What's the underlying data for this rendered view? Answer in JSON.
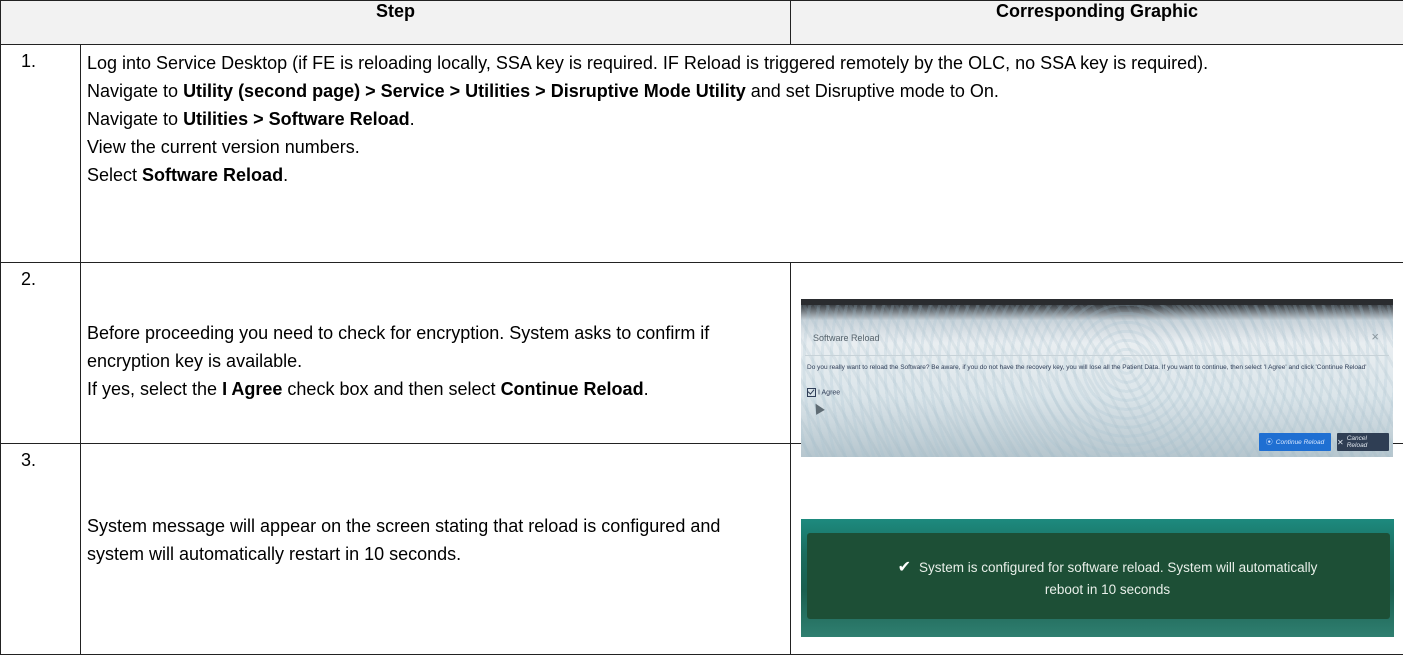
{
  "header": {
    "step": "Step",
    "graphic": "Corresponding Graphic"
  },
  "rows": [
    {
      "number": "1.",
      "line1": "Log into Service Desktop (if FE is reloading locally, SSA key is required. IF Reload is triggered remotely by the OLC, no SSA key is required).",
      "line2_prefix": "Navigate to ",
      "line2_bold": "Utility (second page) > Service > Utilities > Disruptive Mode Utility",
      "line2_suffix": " and set Disruptive mode to On.",
      "line3_prefix": "Navigate to ",
      "line3_bold": "Utilities > Software Reload",
      "line3_suffix": ".",
      "line4": "View the current version numbers.",
      "line5_prefix": "Select ",
      "line5_bold": "Software Reload",
      "line5_suffix": "."
    },
    {
      "number": "2.",
      "line1": "Before proceeding you need to check for encryption. System asks to confirm if encryption key is available.",
      "line2_prefix": "If yes, select the ",
      "line2_bold1": "I Agree",
      "line2_mid": " check box and then select ",
      "line2_bold2": "Continue Reload",
      "line2_suffix": "."
    },
    {
      "number": "3.",
      "line1": "System message will appear on the screen stating that reload is configured and system will automatically restart in 10 seconds."
    }
  ],
  "graphic_dialog": {
    "title": "Software Reload",
    "close": "×",
    "message": "Do you really want to reload the Software? Be aware, if you do not have the recovery key, you will lose all the Patient Data. If you want to continue, then select 'I Agree' and click 'Continue Reload'",
    "checkbox_label": "I Agree",
    "continue_label": "Continue Reload",
    "cancel_label": "Cancel Reload"
  },
  "graphic_notice": {
    "line1": "System is configured for software reload. System will automatically",
    "line2": "reboot in 10 seconds"
  }
}
